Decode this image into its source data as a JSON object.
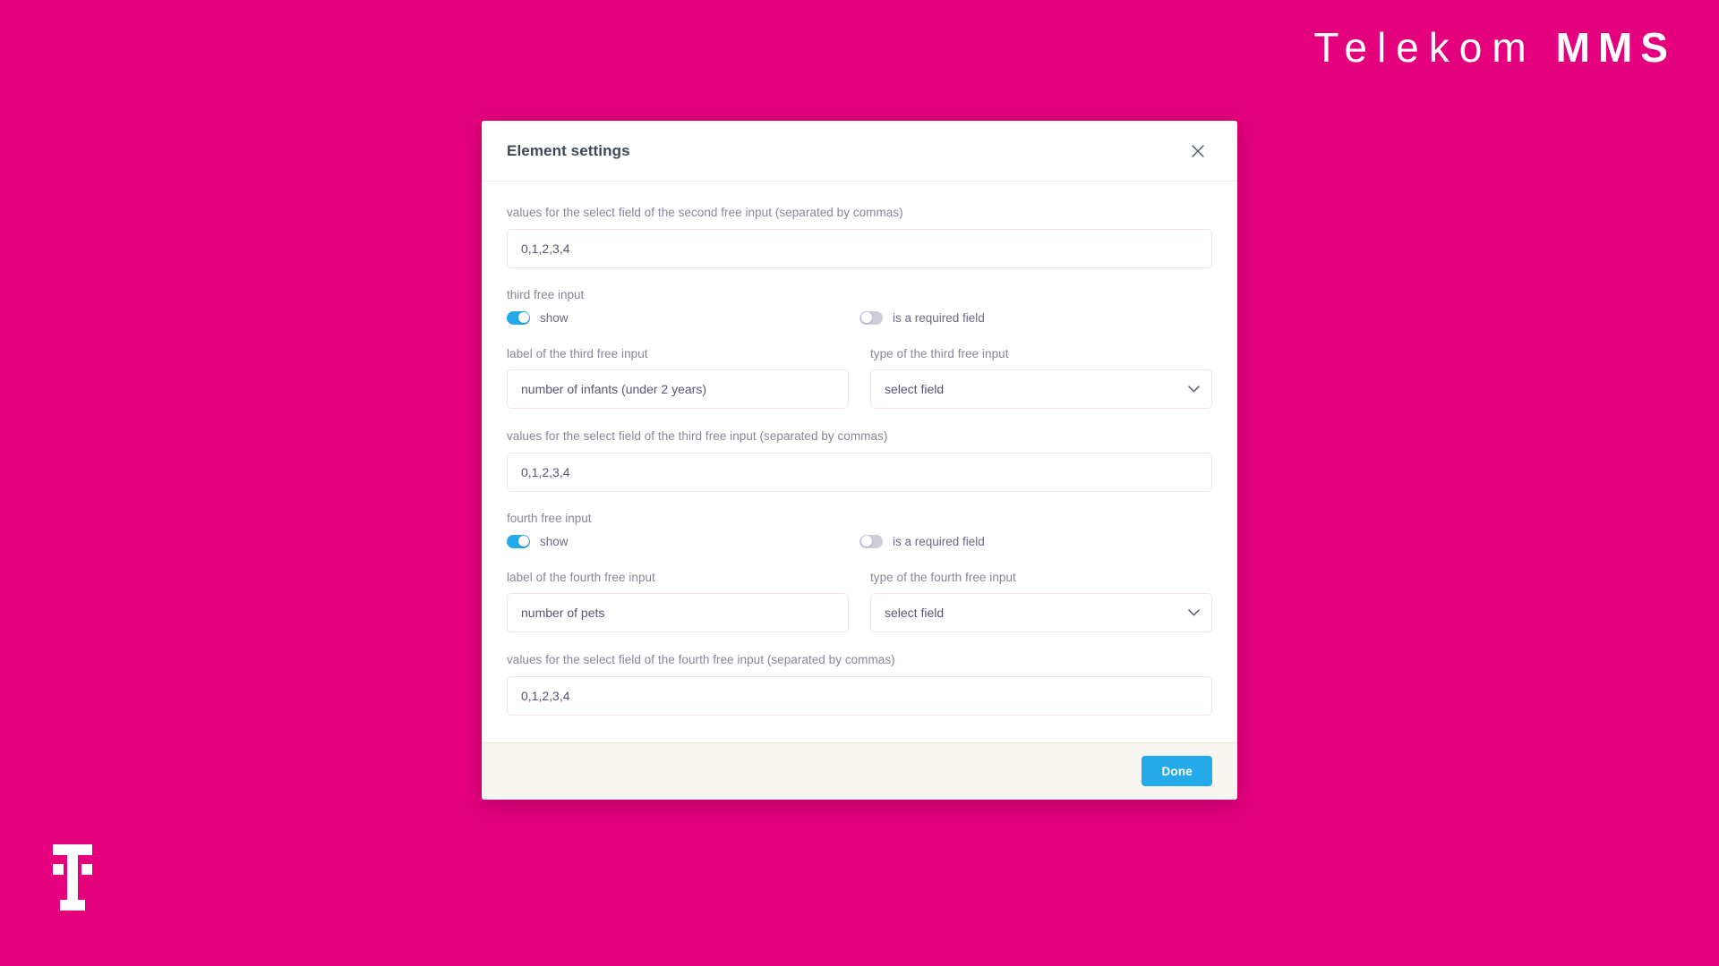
{
  "brand": {
    "word": "Telekom",
    "mms": "MMS",
    "logo_mark": "telekom-t-logo",
    "background_color": "#e4007d"
  },
  "dialog": {
    "title": "Element settings",
    "close_icon": "close-icon",
    "accent_color": "#24a9e9",
    "footer": {
      "done_label": "Done"
    },
    "fields": {
      "second_values": {
        "label": "values for the select field of the second free input (separated by commas)",
        "value": "0,1,2,3,4"
      },
      "third": {
        "section_title": "third free input",
        "show_label": "show",
        "show_on": true,
        "required_label": "is a required field",
        "required_on": false,
        "label_label": "label of the third free input",
        "label_value": "number of infants (under 2 years)",
        "type_label": "type of the third free input",
        "type_value": "select field",
        "values_label": "values for the select field of the third free input (separated by commas)",
        "values_value": "0,1,2,3,4"
      },
      "fourth": {
        "section_title": "fourth free input",
        "show_label": "show",
        "show_on": true,
        "required_label": "is a required field",
        "required_on": false,
        "label_label": "label of the fourth free input",
        "label_value": "number of pets",
        "type_label": "type of the fourth free input",
        "type_value": "select field",
        "values_label": "values for the select field of the fourth free input (separated by commas)",
        "values_value": "0,1,2,3,4"
      }
    }
  }
}
